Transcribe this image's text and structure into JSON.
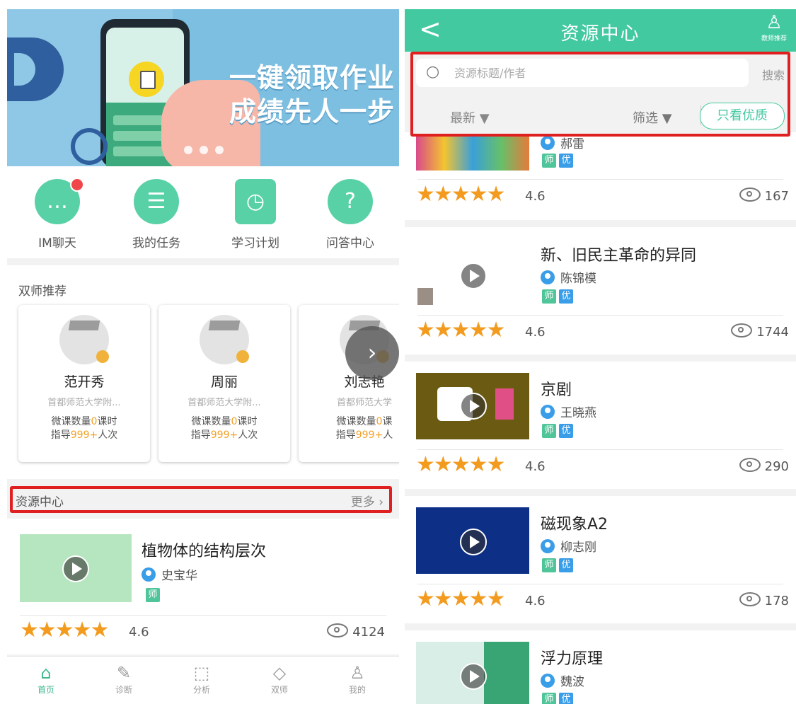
{
  "left": {
    "banner": {
      "line1": "一键领取作业",
      "line2": "成绩先人一步"
    },
    "quick": [
      {
        "label": "IM聊天",
        "icon": "chat-icon"
      },
      {
        "label": "我的任务",
        "icon": "task-list-icon"
      },
      {
        "label": "学习计划",
        "icon": "study-plan-icon"
      },
      {
        "label": "问答中心",
        "icon": "question-icon"
      }
    ],
    "dual": {
      "title": "双师推荐",
      "teachers": [
        {
          "name": "范开秀",
          "school": "首都师范大学附...",
          "courses_label": "微课数量",
          "courses": "0",
          "courses_unit": "课时",
          "guide_label": "指导",
          "guide": "999+",
          "guide_unit": "人次"
        },
        {
          "name": "周丽",
          "school": "首都师范大学附...",
          "courses_label": "微课数量",
          "courses": "0",
          "courses_unit": "课时",
          "guide_label": "指导",
          "guide": "999+",
          "guide_unit": "人次"
        },
        {
          "name": "刘志艳",
          "school": "首都师范大学",
          "courses_label": "微课数量",
          "courses": "0",
          "courses_unit": "课",
          "guide_label": "指导",
          "guide": "999+",
          "guide_unit": "人"
        }
      ]
    },
    "resource_header": {
      "label": "资源中心",
      "more": "更多"
    },
    "resource": {
      "title": "植物体的结构层次",
      "author": "史宝华",
      "tag": "师",
      "score": "4.6",
      "views": "4124",
      "rating": 4.6
    },
    "tabs": [
      {
        "label": "首页",
        "icon": "home-icon"
      },
      {
        "label": "诊断",
        "icon": "diagnosis-icon"
      },
      {
        "label": "分析",
        "icon": "analysis-icon"
      },
      {
        "label": "双师",
        "icon": "graduation-cap-icon"
      },
      {
        "label": "我的",
        "icon": "profile-icon"
      }
    ]
  },
  "right": {
    "header": {
      "back": "<",
      "title": "资源中心",
      "recommend": "教师推荐"
    },
    "search": {
      "placeholder": "资源标题/作者",
      "button": "搜索"
    },
    "filters": {
      "sort": "最新 ▼",
      "filter": "筛选",
      "quality": "只看优质"
    },
    "items": [
      {
        "title": "",
        "author": "郝雷",
        "tag_teacher": "师",
        "tag_quality": "优",
        "score": "4.6",
        "views": "167",
        "rating": 4.6
      },
      {
        "title": "新、旧民主革命的异同",
        "author": "陈锦模",
        "tag_teacher": "师",
        "tag_quality": "优",
        "score": "4.6",
        "views": "1744",
        "rating": 4.6
      },
      {
        "title": "京剧",
        "author": "王晓燕",
        "tag_teacher": "师",
        "tag_quality": "优",
        "score": "4.6",
        "views": "290",
        "rating": 4.6
      },
      {
        "title": "磁现象A2",
        "author": "柳志刚",
        "tag_teacher": "师",
        "tag_quality": "优",
        "score": "4.6",
        "views": "178",
        "rating": 4.6
      },
      {
        "title": "浮力原理",
        "author": "魏波",
        "tag_teacher": "师",
        "tag_quality": "优"
      }
    ]
  },
  "colors": {
    "accent": "#43c9a0",
    "highlight": "#e02020",
    "star": "#f29b1f",
    "tag_blue": "#3a9de8"
  }
}
